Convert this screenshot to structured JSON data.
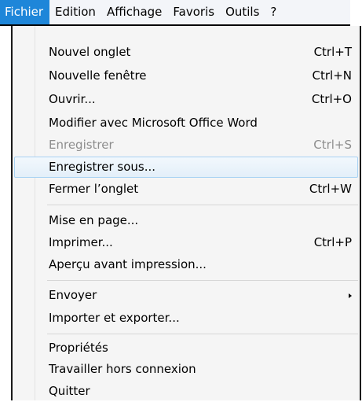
{
  "menubar": {
    "menus": [
      "Fichier",
      "Edition",
      "Affichage",
      "Favoris",
      "Outils",
      "?"
    ]
  },
  "file_menu": {
    "items": [
      {
        "label": "Nouvel onglet",
        "shortcut": "Ctrl+T"
      },
      {
        "label": "Nouvelle fenêtre",
        "shortcut": "Ctrl+N"
      },
      {
        "label": "Ouvrir...",
        "shortcut": "Ctrl+O"
      },
      {
        "label": "Modifier avec Microsoft Office Word",
        "shortcut": ""
      },
      {
        "label": "Enregistrer",
        "shortcut": "Ctrl+S"
      },
      {
        "label": "Enregistrer sous...",
        "shortcut": ""
      },
      {
        "label": "Fermer l’onglet",
        "shortcut": "Ctrl+W"
      },
      {
        "label": "Mise en page...",
        "shortcut": ""
      },
      {
        "label": "Imprimer...",
        "shortcut": "Ctrl+P"
      },
      {
        "label": "Aperçu avant impression...",
        "shortcut": ""
      },
      {
        "label": "Envoyer",
        "shortcut": ""
      },
      {
        "label": "Importer et exporter...",
        "shortcut": ""
      },
      {
        "label": "Propriétés",
        "shortcut": ""
      },
      {
        "label": "Travailler hors connexion",
        "shortcut": ""
      },
      {
        "label": "Quitter",
        "shortcut": ""
      }
    ]
  }
}
